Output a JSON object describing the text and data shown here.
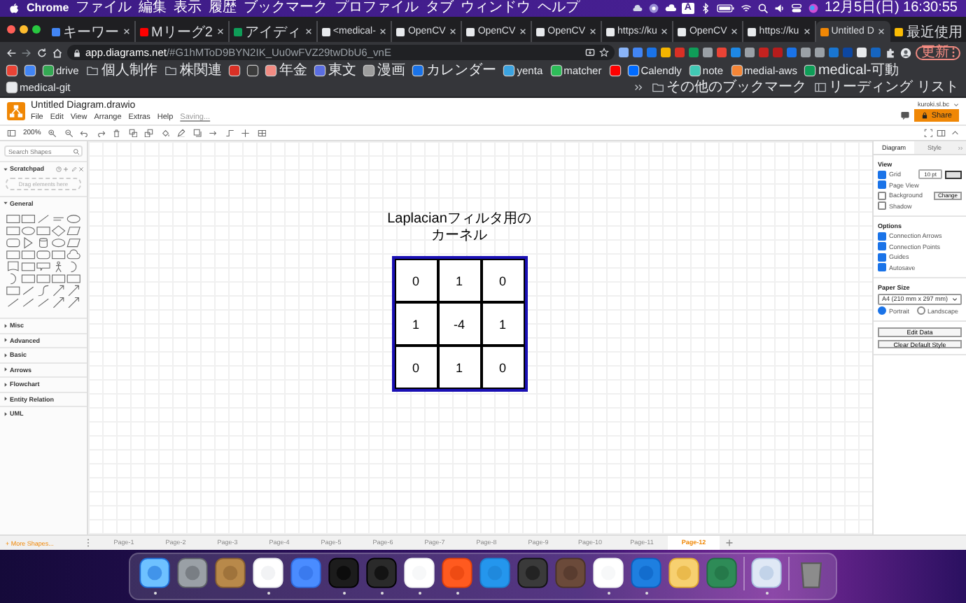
{
  "menubar": {
    "app": "Chrome",
    "menus": [
      "ファイル",
      "編集",
      "表示",
      "履歴",
      "ブックマーク",
      "プロファイル",
      "タブ",
      "ウィンドウ",
      "ヘルプ"
    ],
    "input_mode": "A",
    "clock": "12月5日(日)  16:30:55"
  },
  "browser": {
    "tabs": [
      {
        "title": "キーワー",
        "color": "#4285f4",
        "selected": false
      },
      {
        "title": "Mリーグ2",
        "color": "#ff0000",
        "selected": false
      },
      {
        "title": "アイディ",
        "color": "#0f9d58",
        "selected": false
      },
      {
        "title": "<medical-",
        "color": "#e8eaed",
        "selected": false
      },
      {
        "title": "OpenCV",
        "color": "#e8eaed",
        "selected": false
      },
      {
        "title": "OpenCV",
        "color": "#e8eaed",
        "selected": false
      },
      {
        "title": "OpenCV",
        "color": "#e8eaed",
        "selected": false
      },
      {
        "title": "https://ku",
        "color": "#e8eaed",
        "selected": false
      },
      {
        "title": "OpenCV",
        "color": "#e8eaed",
        "selected": false
      },
      {
        "title": "https://ku",
        "color": "#e8eaed",
        "selected": false
      },
      {
        "title": "Untitled D",
        "color": "#f08705",
        "selected": true
      },
      {
        "title": "最近使用",
        "color": "#fbbc04",
        "selected": false
      }
    ],
    "url_host": "app.diagrams.net",
    "url_path": "/#G1hMToD9BYN2IK_Uu0wFVZ29twDbU6_vnE",
    "update_button": "更新",
    "bookmarks": [
      {
        "kind": "link",
        "color": "#ea4335"
      },
      {
        "kind": "link",
        "color": "#4285f4"
      },
      {
        "kind": "link",
        "label": "drive",
        "color": "#34a853"
      },
      {
        "kind": "folder",
        "label": "個人制作"
      },
      {
        "kind": "folder",
        "label": "株関連"
      },
      {
        "kind": "link",
        "color": "#d93025"
      },
      {
        "kind": "link",
        "color": "#3c3c3c"
      },
      {
        "kind": "link",
        "label": "年金",
        "color": "#f28b82"
      },
      {
        "kind": "link",
        "label": "東文",
        "color": "#5b6ee1"
      },
      {
        "kind": "link",
        "label": "漫画",
        "color": "#9e9e9e"
      },
      {
        "kind": "link",
        "label": "カレンダー",
        "color": "#1a73e8"
      },
      {
        "kind": "link",
        "label": "yenta",
        "color": "#3ba3e0"
      },
      {
        "kind": "link",
        "label": "matcher",
        "color": "#2ebd59"
      },
      {
        "kind": "link",
        "color": "#ff0000"
      },
      {
        "kind": "link",
        "label": "Calendly",
        "color": "#006bff"
      },
      {
        "kind": "link",
        "label": "note",
        "color": "#41c9b4"
      },
      {
        "kind": "link",
        "label": "medial-aws",
        "color": "#f58536"
      },
      {
        "kind": "link",
        "label": "medical-可動",
        "color": "#0f9d58"
      },
      {
        "kind": "link",
        "label": "medical-git",
        "color": "#e8eaed"
      }
    ],
    "bookmarks_right": [
      {
        "kind": "folder",
        "label": "その他のブックマーク"
      },
      {
        "kind": "reading",
        "label": "リーディング リスト"
      }
    ]
  },
  "drawio": {
    "file_title": "Untitled Diagram.drawio",
    "menus": [
      "File",
      "Edit",
      "View",
      "Arrange",
      "Extras",
      "Help"
    ],
    "save_status": "Saving...",
    "zoom": "200%",
    "account": "kuroki.sl.bc",
    "share_button": "Share"
  },
  "sidebar": {
    "search": {
      "placeholder": "Search Shapes"
    },
    "scratchpad": {
      "title": "Scratchpad",
      "expanded": true,
      "drop_hint": "Drag elements here"
    },
    "general": {
      "title": "General",
      "expanded": true
    },
    "sections": [
      {
        "title": "Misc",
        "expanded": false
      },
      {
        "title": "Advanced",
        "expanded": false
      },
      {
        "title": "Basic",
        "expanded": false
      },
      {
        "title": "Arrows",
        "expanded": false
      },
      {
        "title": "Flowchart",
        "expanded": false
      },
      {
        "title": "Entity Relation",
        "expanded": false
      },
      {
        "title": "UML",
        "expanded": false
      }
    ],
    "more_shapes": "+ More Shapes..."
  },
  "canvas": {
    "title": "Laplacianフィルタ用のカーネル",
    "kernel": [
      [
        "0",
        "1",
        "0"
      ],
      [
        "1",
        "-4",
        "1"
      ],
      [
        "0",
        "1",
        "0"
      ]
    ]
  },
  "format_panel": {
    "tabs": [
      {
        "label": "Diagram",
        "selected": true
      },
      {
        "label": "Style",
        "selected": false
      }
    ],
    "view_heading": "View",
    "view_options": [
      {
        "label": "Grid",
        "checked": true
      },
      {
        "label": "Page View",
        "checked": true
      },
      {
        "label": "Background",
        "checked": false
      },
      {
        "label": "Shadow",
        "checked": false
      }
    ],
    "grid_size": "10 pt",
    "change_button": "Change",
    "options_heading": "Options",
    "options": [
      {
        "label": "Connection Arrows",
        "checked": true
      },
      {
        "label": "Connection Points",
        "checked": true
      },
      {
        "label": "Guides",
        "checked": true
      },
      {
        "label": "Autosave",
        "checked": true
      }
    ],
    "paper_heading": "Paper Size",
    "paper_size": "A4 (210 mm x 297 mm)",
    "orientations": [
      {
        "label": "Portrait",
        "selected": true
      },
      {
        "label": "Landscape",
        "selected": false
      }
    ],
    "buttons": [
      "Edit Data",
      "Clear Default Style"
    ]
  },
  "pages": [
    {
      "label": "Page-1",
      "selected": false
    },
    {
      "label": "Page-2",
      "selected": false
    },
    {
      "label": "Page-3",
      "selected": false
    },
    {
      "label": "Page-4",
      "selected": false
    },
    {
      "label": "Page-5",
      "selected": false
    },
    {
      "label": "Page-6",
      "selected": false
    },
    {
      "label": "Page-7",
      "selected": false
    },
    {
      "label": "Page-8",
      "selected": false
    },
    {
      "label": "Page-9",
      "selected": false
    },
    {
      "label": "Page-10",
      "selected": false
    },
    {
      "label": "Page-11",
      "selected": false
    },
    {
      "label": "Page-12",
      "selected": true
    }
  ],
  "dock": [
    {
      "running": true
    },
    {
      "running": false
    },
    {
      "running": false
    },
    {
      "running": true
    },
    {
      "running": false
    },
    {
      "running": true
    },
    {
      "running": true
    },
    {
      "running": true
    },
    {
      "running": true
    },
    {
      "running": false
    },
    {
      "running": false
    },
    {
      "running": false
    },
    {
      "running": true
    },
    {
      "running": true
    },
    {
      "running": false
    },
    {
      "running": false
    },
    {
      "running": true
    },
    {
      "running": false
    }
  ]
}
